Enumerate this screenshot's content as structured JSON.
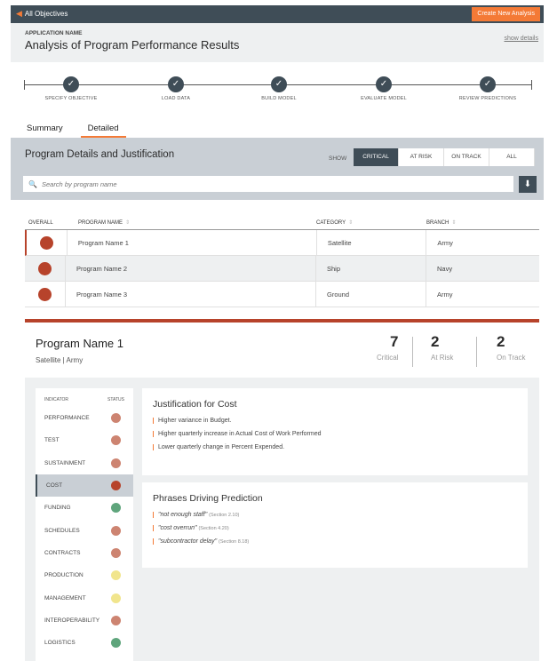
{
  "topbar": {
    "back_label": "All Objectives",
    "create_label": "Create New Analysis"
  },
  "header": {
    "app_name": "APPLICATION NAME",
    "title": "Analysis of Program Performance Results",
    "show_details": "show details"
  },
  "steps": [
    {
      "label": "SPECIFY OBJECTIVE"
    },
    {
      "label": "LOAD DATA"
    },
    {
      "label": "BUILD MODEL"
    },
    {
      "label": "EVALUATE MODEL"
    },
    {
      "label": "REVIEW PREDICTIONS"
    }
  ],
  "tabs": [
    {
      "label": "Summary"
    },
    {
      "label": "Detailed"
    }
  ],
  "filter": {
    "title": "Program Details and Justification",
    "show_label": "SHOW",
    "options": [
      "CRITICAL",
      "AT RISK",
      "ON TRACK",
      "ALL"
    ],
    "search_placeholder": "Search by program name"
  },
  "table": {
    "headers": [
      "OVERALL",
      "PROGRAM NAME",
      "CATEGORY",
      "BRANCH"
    ],
    "rows": [
      {
        "name": "Program Name 1",
        "category": "Satellite",
        "branch": "Army"
      },
      {
        "name": "Program Name 2",
        "category": "Ship",
        "branch": "Navy"
      },
      {
        "name": "Program Name 3",
        "category": "Ground",
        "branch": "Army"
      }
    ]
  },
  "detail": {
    "name": "Program Name 1",
    "subtitle": "Satellite | Army",
    "stats": [
      {
        "value": "7",
        "label": "Critical"
      },
      {
        "value": "2",
        "label": "At Risk"
      },
      {
        "value": "2",
        "label": "On Track"
      }
    ],
    "indicator_header": "INDICATOR",
    "status_header": "STATUS",
    "indicators": [
      {
        "label": "PERFORMANCE",
        "color": "#cd8471"
      },
      {
        "label": "TEST",
        "color": "#cd8471"
      },
      {
        "label": "SUSTAINMENT",
        "color": "#cd8471"
      },
      {
        "label": "COST",
        "color": "#b7432b"
      },
      {
        "label": "FUNDING",
        "color": "#5fa57c"
      },
      {
        "label": "SCHEDULES",
        "color": "#cd8471"
      },
      {
        "label": "CONTRACTS",
        "color": "#cd8471"
      },
      {
        "label": "PRODUCTION",
        "color": "#f1e58d"
      },
      {
        "label": "MANAGEMENT",
        "color": "#f1e58d"
      },
      {
        "label": "INTEROPERABILITY",
        "color": "#cd8471"
      },
      {
        "label": "LOGISTICS",
        "color": "#5fa57c"
      }
    ],
    "justification": {
      "title": "Justification for Cost",
      "lines": [
        "Higher variance in Budget.",
        "Higher quarterly increase in Actual Cost of Work Performed",
        "Lower quarterly change in Percent Expended."
      ]
    },
    "phrases": {
      "title": "Phrases Driving Prediction",
      "items": [
        {
          "text": "\"not enough staff\"",
          "ref": "(Section 2.10)"
        },
        {
          "text": "\"cost overrun\"",
          "ref": "(Section 4.20)"
        },
        {
          "text": "\"subcontractor delay\"",
          "ref": "(Section 8.18)"
        }
      ]
    }
  },
  "colors": {
    "accent": "#f47a36",
    "dark": "#3f4d57",
    "critical": "#b7432b"
  }
}
